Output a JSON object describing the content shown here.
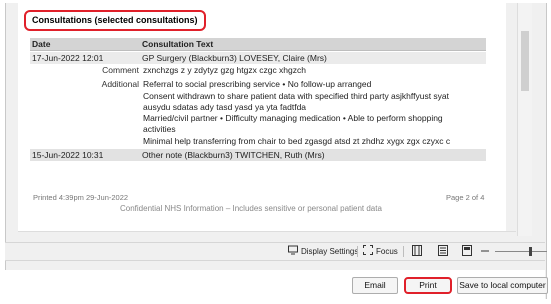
{
  "report": {
    "heading": "Consultations (selected consultations)",
    "columns": {
      "date": "Date",
      "text": "Consultation Text"
    },
    "entries": [
      {
        "date": "17-Jun-2022 12:01",
        "summary": "GP Surgery (Blackburn3)  LOVESEY, Claire (Mrs)",
        "comment_label": "Comment",
        "comment": "zxnchzgs z y zdytyz gzg htgzx czgc xhgzch",
        "additional_label": "Additional",
        "additional_lines": [
          "Referral to social prescribing service  • No follow-up arranged",
          "Consent withdrawn to share patient data with specified third party asjkhffyust syat",
          "ausydu sdatas ady tasd yasd ya yta fadtfda",
          "Married/civil partner  • Difficulty managing medication  • Able to perform shopping",
          "activities",
          "Minimal help transferring from chair to bed zgasgd atsd zt zhdhz xygx zgx czyxc c"
        ]
      },
      {
        "date": "15-Jun-2022 10:31",
        "summary": "Other note (Blackburn3)  TWITCHEN, Ruth (Mrs)"
      }
    ],
    "printed": "Printed 4:39pm 29-Jun-2022",
    "page": "Page 2 of 4",
    "confidential": "Confidential NHS Information – Includes sensitive or personal patient data"
  },
  "toolbar": {
    "display_settings": "Display Settings",
    "focus": "Focus"
  },
  "buttons": {
    "email": "Email",
    "print": "Print",
    "save_local": "Save to local computer"
  },
  "colors": {
    "highlight": "#e0202a",
    "header_bg": "#d4d4d4"
  }
}
